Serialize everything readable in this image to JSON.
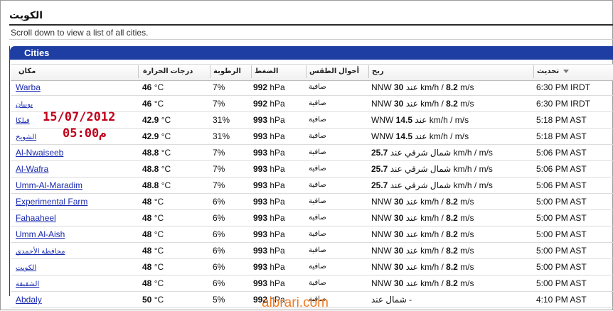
{
  "page": {
    "title": "الكويت",
    "subtitle": "Scroll down to view a list of all cities."
  },
  "panel": {
    "title": "Cities"
  },
  "columns": {
    "place": "مكان",
    "temperature": "درجات الحرارة",
    "humidity": "الرطوبة",
    "pressure": "الضغط",
    "conditions": "أحوال الطقس",
    "wind": "ريح",
    "update": "تحديث"
  },
  "rows": [
    {
      "place": "Warba",
      "temp": "46",
      "temp_unit": " °C",
      "hum": "7%",
      "pres": "992",
      "pres_unit": " hPa",
      "cond": "صافية",
      "wind_dir": "NNW ",
      "wind_speed": "30",
      "wind_rest": " عند km/h / ",
      "wind_ms": "8.2",
      "wind_ms_unit": " m/s",
      "update": "6:30 PM IRDT"
    },
    {
      "place": "بوبيان",
      "temp": "46",
      "temp_unit": " °C",
      "hum": "7%",
      "pres": "992",
      "pres_unit": " hPa",
      "cond": "صافية",
      "wind_dir": "NNW ",
      "wind_speed": "30",
      "wind_rest": " عند km/h / ",
      "wind_ms": "8.2",
      "wind_ms_unit": " m/s",
      "update": "6:30 PM IRDT"
    },
    {
      "place": "فيلكا",
      "temp": "42.9",
      "temp_unit": " °C",
      "hum": "31%",
      "pres": "993",
      "pres_unit": " hPa",
      "cond": "صافية",
      "wind_dir": "WNW ",
      "wind_speed": "14.5",
      "wind_rest": " عند km/h / ",
      "wind_ms": "",
      "wind_ms_unit": " m/s",
      "update": "5:18 PM AST"
    },
    {
      "place": "الشويخ",
      "temp": "42.9",
      "temp_unit": " °C",
      "hum": "31%",
      "pres": "993",
      "pres_unit": " hPa",
      "cond": "صافية",
      "wind_dir": "WNW ",
      "wind_speed": "14.5",
      "wind_rest": " عند km/h / ",
      "wind_ms": "",
      "wind_ms_unit": " m/s",
      "update": "5:18 PM AST"
    },
    {
      "place": "Al-Nwaiseeb",
      "temp": "48.8",
      "temp_unit": " °C",
      "hum": "7%",
      "pres": "993",
      "pres_unit": " hPa",
      "cond": "صافية",
      "wind_dir": "",
      "wind_speed": "25.7",
      "wind_rest": " شمال شرقي عند km/h / ",
      "wind_ms": "",
      "wind_ms_unit": " m/s",
      "update": "5:06 PM AST"
    },
    {
      "place": "Al-Wafra",
      "temp": "48.8",
      "temp_unit": " °C",
      "hum": "7%",
      "pres": "993",
      "pres_unit": " hPa",
      "cond": "صافية",
      "wind_dir": "",
      "wind_speed": "25.7",
      "wind_rest": " شمال شرقي عند km/h / ",
      "wind_ms": "",
      "wind_ms_unit": " m/s",
      "update": "5:06 PM AST"
    },
    {
      "place": "Umm-Al-Maradim",
      "temp": "48.8",
      "temp_unit": " °C",
      "hum": "7%",
      "pres": "993",
      "pres_unit": " hPa",
      "cond": "صافية",
      "wind_dir": "",
      "wind_speed": "25.7",
      "wind_rest": " شمال شرقي عند km/h / ",
      "wind_ms": "",
      "wind_ms_unit": " m/s",
      "update": "5:06 PM AST"
    },
    {
      "place": "Experimental Farm",
      "temp": "48",
      "temp_unit": " °C",
      "hum": "6%",
      "pres": "993",
      "pres_unit": " hPa",
      "cond": "صافية",
      "wind_dir": "NNW ",
      "wind_speed": "30",
      "wind_rest": " عند km/h / ",
      "wind_ms": "8.2",
      "wind_ms_unit": " m/s",
      "update": "5:00 PM AST"
    },
    {
      "place": "Fahaaheel",
      "temp": "48",
      "temp_unit": " °C",
      "hum": "6%",
      "pres": "993",
      "pres_unit": " hPa",
      "cond": "صافية",
      "wind_dir": "NNW ",
      "wind_speed": "30",
      "wind_rest": " عند km/h / ",
      "wind_ms": "8.2",
      "wind_ms_unit": " m/s",
      "update": "5:00 PM AST"
    },
    {
      "place": "Umm Al-Aish",
      "temp": "48",
      "temp_unit": " °C",
      "hum": "6%",
      "pres": "993",
      "pres_unit": " hPa",
      "cond": "صافية",
      "wind_dir": "NNW ",
      "wind_speed": "30",
      "wind_rest": " عند km/h / ",
      "wind_ms": "8.2",
      "wind_ms_unit": " m/s",
      "update": "5:00 PM AST"
    },
    {
      "place": "محافظة الأحمدي",
      "temp": "48",
      "temp_unit": " °C",
      "hum": "6%",
      "pres": "993",
      "pres_unit": " hPa",
      "cond": "صافية",
      "wind_dir": "NNW ",
      "wind_speed": "30",
      "wind_rest": " عند km/h / ",
      "wind_ms": "8.2",
      "wind_ms_unit": " m/s",
      "update": "5:00 PM AST"
    },
    {
      "place": "الكويت",
      "temp": "48",
      "temp_unit": " °C",
      "hum": "6%",
      "pres": "993",
      "pres_unit": " hPa",
      "cond": "صافية",
      "wind_dir": "NNW ",
      "wind_speed": "30",
      "wind_rest": " عند km/h / ",
      "wind_ms": "8.2",
      "wind_ms_unit": " m/s",
      "update": "5:00 PM AST"
    },
    {
      "place": "الشقيقة",
      "temp": "48",
      "temp_unit": " °C",
      "hum": "6%",
      "pres": "993",
      "pres_unit": " hPa",
      "cond": "صافية",
      "wind_dir": "NNW ",
      "wind_speed": "30",
      "wind_rest": " عند km/h / ",
      "wind_ms": "8.2",
      "wind_ms_unit": " m/s",
      "update": "5:00 PM AST"
    },
    {
      "place": "Abdaly",
      "temp": "50",
      "temp_unit": " °C",
      "hum": "5%",
      "pres": "992",
      "pres_unit": " hPa",
      "cond": "صافية",
      "wind_dir": "",
      "wind_speed": "",
      "wind_rest": "شمال عند -",
      "wind_ms": "",
      "wind_ms_unit": "",
      "update": "4:10 PM AST"
    }
  ],
  "overlay": {
    "date": "15/07/2012",
    "time": "05:00م"
  },
  "watermark": "albrari.com",
  "colors": {
    "panel_header": "#1e3ea3",
    "link": "#1a2bb0",
    "overlay": "#c0001a",
    "watermark": "#f07a22"
  }
}
